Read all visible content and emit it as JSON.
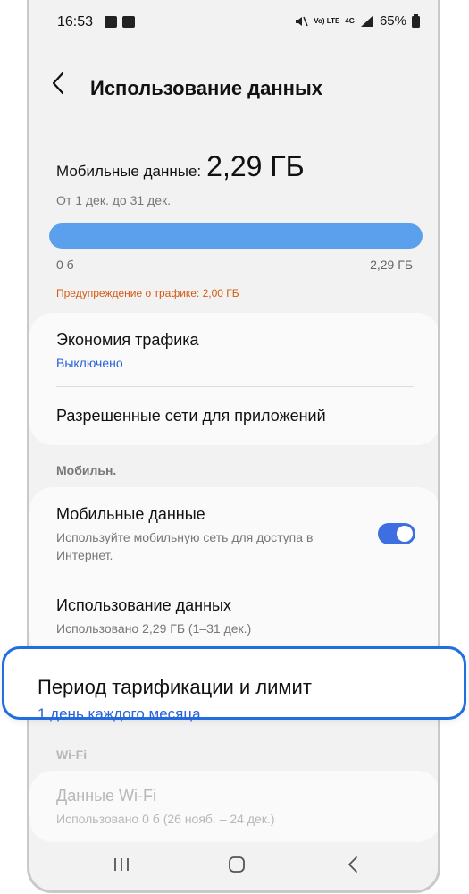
{
  "status_bar": {
    "time": "16:53",
    "battery": "65%",
    "net": "4G",
    "volte": "Vo) LTE"
  },
  "header": {
    "title": "Использование данных"
  },
  "usage": {
    "mobile_label": "Мобильные данные:",
    "mobile_value": "2,29 ГБ",
    "period": "От 1 дек. до 31 дек.",
    "bar_fraction": 1.0,
    "bar_min": "0 б",
    "bar_max": "2,29 ГБ",
    "warning": "Предупреждение о трафике: 2,00 ГБ"
  },
  "card1": {
    "saver_title": "Экономия трафика",
    "saver_status": "Выключено",
    "allowed_title": "Разрешенные сети для приложений"
  },
  "section_mobile": "Мобильн.",
  "card2": {
    "mobile_title": "Мобильные данные",
    "mobile_sub": "Используйте мобильную сеть для доступа в Интернет.",
    "mobile_toggle": "on",
    "usage_title": "Использование данных",
    "usage_sub": "Использовано 2,29 ГБ (1–31 дек.)"
  },
  "highlight": {
    "title": "Период тарификации и лимит",
    "sub": "1 день каждого месяца"
  },
  "section_wifi": "Wi-Fi",
  "card3": {
    "wifi_title": "Данные Wi-Fi",
    "wifi_sub": "Использовано 0 б (26 нояб. – 24 дек.)"
  },
  "colors": {
    "accent": "#2a62d8",
    "bar": "#5aa0ec",
    "warning": "#d65a12",
    "highlight_border": "#1f6fe0"
  },
  "icons": [
    "gallery-icon",
    "samsung-s-icon",
    "mute-icon",
    "signal-icon",
    "battery-icon",
    "back-arrow-icon",
    "recents-icon",
    "home-icon",
    "back-nav-icon"
  ]
}
